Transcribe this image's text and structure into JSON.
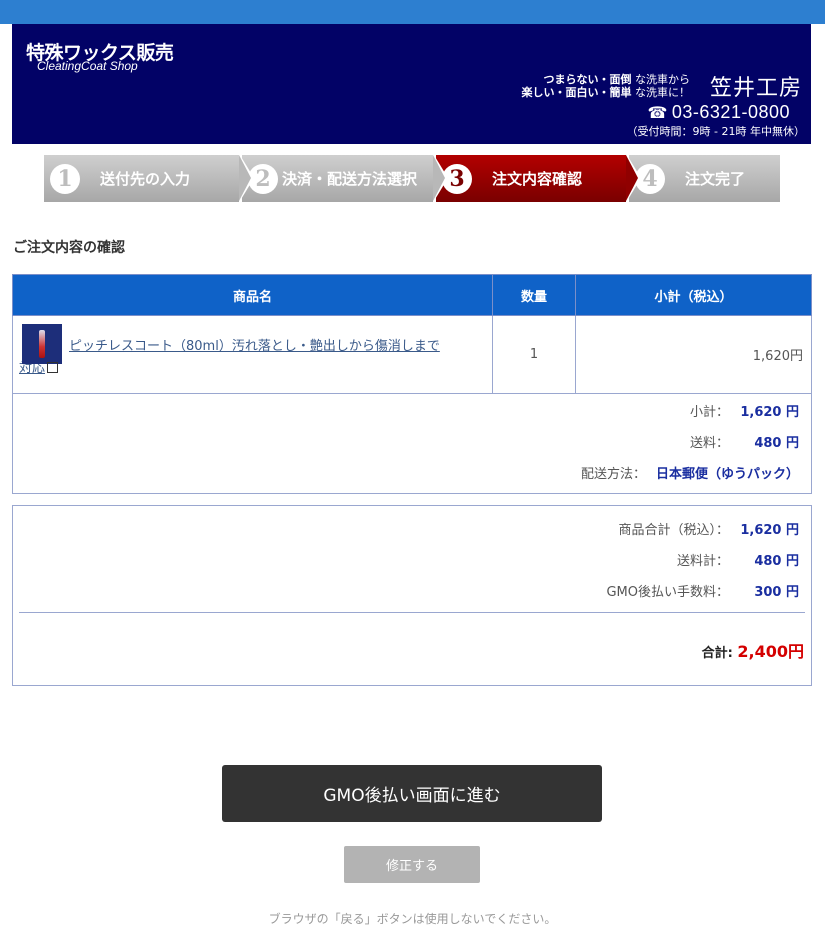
{
  "header": {
    "shop_name": "特殊ワックス販売",
    "shop_sub": "CleatingCoat Shop",
    "tagline_line1_bold": "つまらない・面倒",
    "tagline_line1_rest": " な洗車から",
    "tagline_line2_bold": "楽しい・面白い・簡単",
    "tagline_line2_rest": " な洗車に！",
    "brand": "笠井工房",
    "phone": "03-6321-0800",
    "hours": "（受付時間：9時 - 21時  年中無休）",
    "colors": {
      "topbar": "#2d7fd0",
      "banner": "#020266"
    }
  },
  "steps": [
    {
      "num": "1",
      "label": "送付先の入力",
      "active": false
    },
    {
      "num": "2",
      "label": "決済・配送方法選択",
      "active": false
    },
    {
      "num": "3",
      "label": "注文内容確認",
      "active": true
    },
    {
      "num": "4",
      "label": "注文完了",
      "active": false
    }
  ],
  "section_title": "ご注文内容の確認",
  "table": {
    "headers": {
      "product": "商品名",
      "qty": "数量",
      "subtotal": "小計（税込）"
    },
    "rows": [
      {
        "product_line1": "ピッチレスコート（80ml）汚れ落とし・艶出しから傷消しまで",
        "product_line2": "対応",
        "qty": "1",
        "subtotal": "1,620円"
      }
    ]
  },
  "summary1": {
    "subtotal_label": "小計：",
    "subtotal_value": "1,620 円",
    "shipping_label": "送料：",
    "shipping_value": "480 円",
    "method_label": "配送方法：",
    "method_value": "日本郵便（ゆうパック）"
  },
  "summary2": {
    "goods_total_label": "商品合計（税込）：",
    "goods_total_value": "1,620 円",
    "shipping_total_label": "送料計：",
    "shipping_total_value": "480 円",
    "fee_label": "GMO後払い手数料：",
    "fee_value": "300 円",
    "total_label": "合計:",
    "total_value": "2,400円",
    "colors": {
      "total": "#d40000",
      "values": "#1a2ea0"
    }
  },
  "actions": {
    "gmo_button": "GMO後払い画面に進む",
    "fix_button": "修正する",
    "note": "ブラウザの「戻る」ボタンは使用しないでください。"
  }
}
